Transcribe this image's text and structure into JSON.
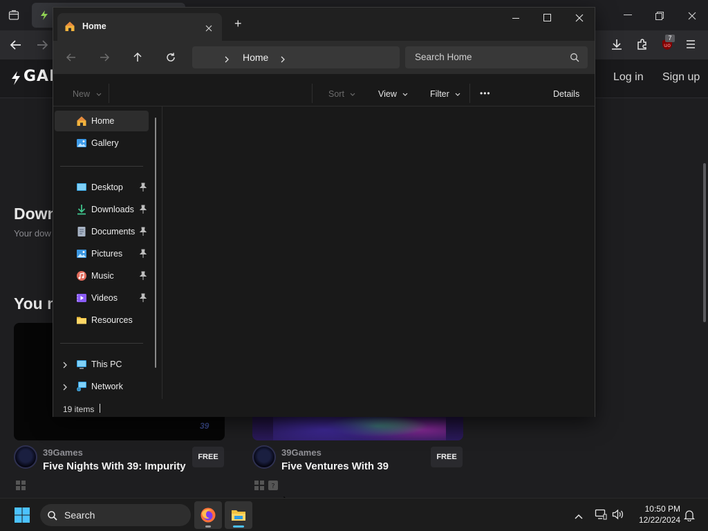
{
  "browser": {
    "site": {
      "logo": "GAM",
      "login_label": "Log in",
      "signup_label": "Sign up",
      "heading_downloads": "Down",
      "subtext_downloads": "Your dow",
      "heading_you_may": "You m",
      "cards": [
        {
          "author": "39Games",
          "title": "Five Nights With 39: Impurity",
          "badge": "FREE"
        },
        {
          "author": "39Games",
          "title": "Five Ventures With 39",
          "badge": "FREE"
        }
      ]
    },
    "toolbar": {
      "extension_badge": "7"
    }
  },
  "explorer": {
    "tab_title": "Home",
    "new_tab_label": "+",
    "breadcrumb": [
      "Home"
    ],
    "search_placeholder": "Search Home",
    "commands": {
      "new_label": "New",
      "sort_label": "Sort",
      "view_label": "View",
      "filter_label": "Filter",
      "more_label": "•••",
      "details_label": "Details"
    },
    "nav_top": [
      {
        "label": "Home",
        "icon": "home-icon",
        "selected": true
      },
      {
        "label": "Gallery",
        "icon": "gallery-icon"
      }
    ],
    "nav_pinned": [
      {
        "label": "Desktop",
        "icon": "desktop-icon",
        "pinned": true
      },
      {
        "label": "Downloads",
        "icon": "downloads-icon",
        "pinned": true
      },
      {
        "label": "Documents",
        "icon": "documents-icon",
        "pinned": true
      },
      {
        "label": "Pictures",
        "icon": "pictures-icon",
        "pinned": true
      },
      {
        "label": "Music",
        "icon": "music-icon",
        "pinned": true
      },
      {
        "label": "Videos",
        "icon": "videos-icon",
        "pinned": true
      },
      {
        "label": "Resources",
        "icon": "folder-icon",
        "pinned": false
      }
    ],
    "nav_bottom": [
      {
        "label": "This PC",
        "icon": "this-pc-icon"
      },
      {
        "label": "Network",
        "icon": "network-icon"
      }
    ],
    "status": {
      "items_count": "19 items"
    }
  },
  "taskbar": {
    "search_label": "Search",
    "clock_time": "10:50 PM",
    "clock_date": "12/22/2024"
  },
  "colors": {
    "accent": "#4cc2ff",
    "folder_yellow": "#f4c23f",
    "firefox_orange": "#ff7139"
  }
}
